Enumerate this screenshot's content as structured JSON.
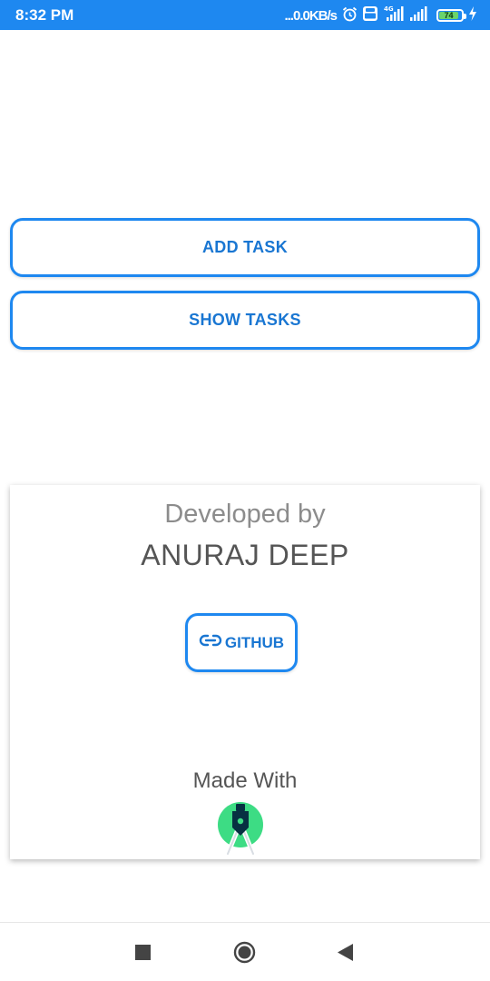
{
  "status_bar": {
    "time": "8:32 PM",
    "network_speed": "...0.0KB/s",
    "network_type": "4G",
    "battery_level": "74",
    "icons": [
      "alarm-icon",
      "volte-icon",
      "signal-icon",
      "signal-icon",
      "battery-icon",
      "charging-icon"
    ]
  },
  "actions": {
    "add_task": "ADD TASK",
    "show_tasks": "SHOW TASKS"
  },
  "card": {
    "developed_by": "Developed by",
    "developer_name": "ANURAJ DEEP",
    "github_label": "GITHUB",
    "made_with": "Made With",
    "logo_icon": "android-studio-logo"
  },
  "navigation": {
    "items": [
      "recents-button",
      "home-button",
      "back-button"
    ]
  },
  "colors": {
    "accent": "#1e88f0",
    "button_text": "#1976d2",
    "status_bar": "#1e88f0"
  }
}
